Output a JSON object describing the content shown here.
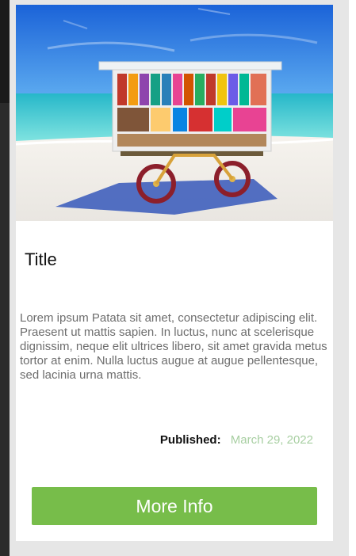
{
  "card": {
    "image_alt": "Colorful vendor cart on a tropical beach",
    "title": "Title",
    "body": "Lorem ipsum Patata sit amet, consectetur adipiscing elit. Praesent ut mattis sapien. In luctus, nunc at scelerisque dignissim, neque elit ultrices libero, sit amet gravida metus tortor at enim. Nulla luctus augue at augue pellentesque, sed lacinia urna mattis.",
    "published_label": "Published:",
    "published_date": "March 29, 2022",
    "button_label": "More Info"
  },
  "colors": {
    "button": "#77bd4a",
    "date": "#a8cfa2",
    "page_bg": "#e6e6e6",
    "card_bg": "#ffffff"
  }
}
